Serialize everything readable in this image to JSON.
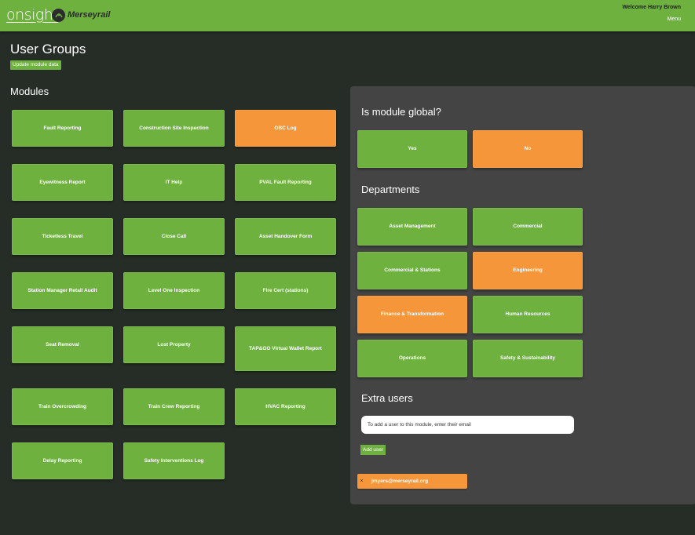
{
  "header": {
    "brand": "onsight",
    "partner": "Merseyrail",
    "welcome": "Welcome Harry Brown",
    "menu": "Menu"
  },
  "page": {
    "title": "User Groups",
    "update_button": "Update module data"
  },
  "modules": {
    "title": "Modules",
    "items": [
      {
        "label": "Fault Reporting",
        "state": "green"
      },
      {
        "label": "Construction Site Inspection",
        "state": "green"
      },
      {
        "label": "OBC Log",
        "state": "orange"
      },
      {
        "label": "Eyewitness Report",
        "state": "green"
      },
      {
        "label": "IT Help",
        "state": "green"
      },
      {
        "label": "PVAL Fault Reporting",
        "state": "green"
      },
      {
        "label": "Ticketless Travel",
        "state": "green"
      },
      {
        "label": "Close Call",
        "state": "green"
      },
      {
        "label": "Asset Handover Form",
        "state": "green"
      },
      {
        "label": "Station Manager Retail Audit",
        "state": "green"
      },
      {
        "label": "Level One Inspection",
        "state": "green"
      },
      {
        "label": "Fire Cert (stations)",
        "state": "green"
      },
      {
        "label": "Seat Removal",
        "state": "green"
      },
      {
        "label": "Lost Property",
        "state": "green"
      },
      {
        "label": "TAP&GO Virtual Wallet Report",
        "state": "green"
      },
      {
        "label": "Train Overcrowding",
        "state": "green"
      },
      {
        "label": "Train Crew Reporting",
        "state": "green"
      },
      {
        "label": "HVAC Reporting",
        "state": "green"
      },
      {
        "label": "Delay Reporting",
        "state": "green"
      },
      {
        "label": "Safety Interventions Log",
        "state": "green"
      }
    ]
  },
  "global": {
    "title": "Is module global?",
    "yes": "Yes",
    "no": "No"
  },
  "departments": {
    "title": "Departments",
    "items": [
      {
        "label": "Asset Management",
        "state": "green"
      },
      {
        "label": "Commercial",
        "state": "green"
      },
      {
        "label": "Commercial & Stations",
        "state": "green"
      },
      {
        "label": "Engineering",
        "state": "orange"
      },
      {
        "label": "Finance & Transformation",
        "state": "orange"
      },
      {
        "label": "Human Resources",
        "state": "green"
      },
      {
        "label": "Operations",
        "state": "green"
      },
      {
        "label": "Safety & Sustainability",
        "state": "green"
      }
    ]
  },
  "extra_users": {
    "title": "Extra users",
    "input_placeholder": "To add a user to this module, enter their email",
    "add_button": "Add user",
    "users": [
      {
        "email": "jmyers@merseyrail.org"
      }
    ],
    "remove_glyph": "×"
  },
  "colors": {
    "green": "#6fb13f",
    "orange": "#f5963b",
    "background": "#262d26",
    "panel": "#444444"
  }
}
